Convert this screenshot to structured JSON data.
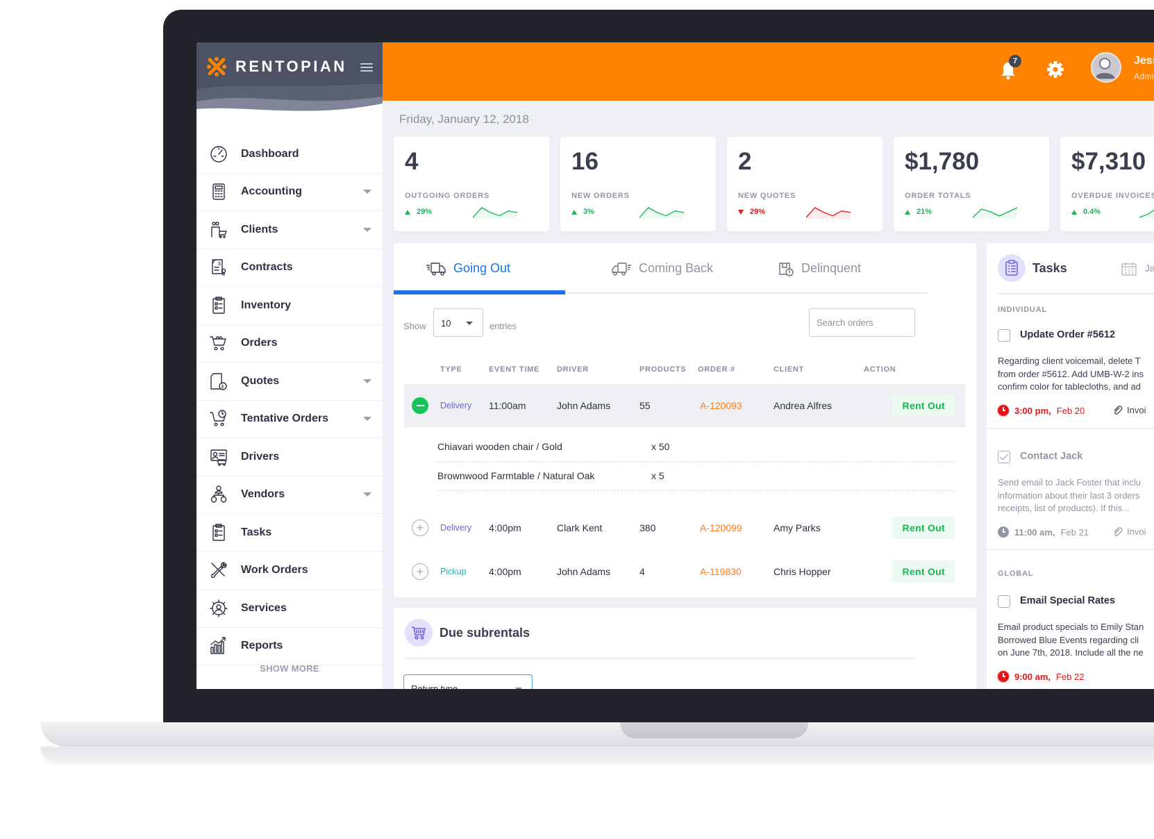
{
  "brand": {
    "name": "RENTOPIAN",
    "accent": "#ff8300",
    "sidebar_bg": "#4c5164"
  },
  "header": {
    "notification_count": "7",
    "user_name": "Jessica",
    "user_role": "Administrator"
  },
  "sidebar": {
    "items": [
      {
        "label": "Dashboard",
        "icon": "dashboard-gauge-icon",
        "expandable": false
      },
      {
        "label": "Accounting",
        "icon": "calculator-icon",
        "expandable": true
      },
      {
        "label": "Clients",
        "icon": "clients-cart-icon",
        "expandable": true
      },
      {
        "label": "Contracts",
        "icon": "contract-document-icon",
        "expandable": false
      },
      {
        "label": "Inventory",
        "icon": "clipboard-checklist-icon",
        "expandable": false
      },
      {
        "label": "Orders",
        "icon": "shopping-cart-icon",
        "expandable": false
      },
      {
        "label": "Quotes",
        "icon": "quote-document-dollar-icon",
        "expandable": true
      },
      {
        "label": "Tentative Orders",
        "icon": "cart-clock-icon",
        "expandable": true
      },
      {
        "label": "Drivers",
        "icon": "driver-id-card-icon",
        "expandable": false
      },
      {
        "label": "Vendors",
        "icon": "vendor-hierarchy-icon",
        "expandable": true
      },
      {
        "label": "Tasks",
        "icon": "clipboard-tasks-icon",
        "expandable": false
      },
      {
        "label": "Work Orders",
        "icon": "wrench-screwdriver-icon",
        "expandable": false
      },
      {
        "label": "Services",
        "icon": "services-gear-user-icon",
        "expandable": false
      },
      {
        "label": "Reports",
        "icon": "bar-chart-growth-icon",
        "expandable": false
      }
    ],
    "show_more": "SHOW MORE"
  },
  "main": {
    "date": "Friday, January 12, 2018",
    "stats": [
      {
        "value": "4",
        "label": "OUTGOING ORDERS",
        "change": "29%",
        "direction": "up",
        "color": "#16b653",
        "trend": [
          2,
          8,
          5,
          3,
          6,
          5
        ]
      },
      {
        "value": "16",
        "label": "NEW ORDERS",
        "change": "3%",
        "direction": "up",
        "color": "#16b653",
        "trend": [
          2,
          8,
          5,
          3,
          6,
          5
        ]
      },
      {
        "value": "2",
        "label": "NEW QUOTES",
        "change": "29%",
        "direction": "down",
        "color": "#e5131a",
        "trend": [
          2,
          8,
          5,
          3,
          6,
          5
        ]
      },
      {
        "value": "$1,780",
        "label": "ORDER TOTALS",
        "change": "21%",
        "direction": "up",
        "color": "#16b653",
        "trend": [
          2,
          8,
          6,
          3,
          6,
          9
        ]
      },
      {
        "value": "$7,310",
        "label": "OVERDUE INVOICES",
        "change": "0.4%",
        "direction": "up",
        "color": "#16b653",
        "trend": [
          2,
          4,
          8,
          7,
          6,
          7
        ]
      }
    ],
    "orders": {
      "tabs": [
        {
          "label": "Going Out",
          "icon": "truck-going-out-icon",
          "active": true
        },
        {
          "label": "Coming Back",
          "icon": "truck-coming-back-icon",
          "active": false
        },
        {
          "label": "Delinquent",
          "icon": "delinquent-package-icon",
          "active": false
        }
      ],
      "show_label": "Show",
      "entries_value": "10",
      "entries_label": "entries",
      "search_placeholder": "Search orders",
      "columns": [
        "TYPE",
        "EVENT TIME",
        "DRIVER",
        "PRODUCTS",
        "ORDER #",
        "CLIENT",
        "ACTION"
      ],
      "rows": [
        {
          "type": "Delivery",
          "type_color": "#6c63e0",
          "time": "11:00am",
          "driver": "John Adams",
          "products": "55",
          "order": "A-120093",
          "client": "Andrea Alfres",
          "action": "Rent Out",
          "expanded": true,
          "items": [
            {
              "name": "Chiavari wooden chair / Gold",
              "qty": "x 50"
            },
            {
              "name": "Brownwood Farmtable / Natural Oak",
              "qty": "x 5"
            }
          ]
        },
        {
          "type": "Delivery",
          "type_color": "#6c63e0",
          "time": "4:00pm",
          "driver": "Clark Kent",
          "products": "380",
          "order": "A-120099",
          "client": "Amy Parks",
          "action": "Rent Out",
          "expanded": false
        },
        {
          "type": "Pickup",
          "type_color": "#1fb5b0",
          "time": "4:00pm",
          "driver": "John Adams",
          "products": "4",
          "order": "A-119830",
          "client": "Chris Hopper",
          "action": "Rent Out",
          "expanded": false
        }
      ]
    },
    "subrentals": {
      "title": "Due subrentals",
      "return_select": "Return type"
    }
  },
  "tasks": {
    "title": "Tasks",
    "calendar_label": "Jan",
    "individual_label": "INDIVIDUAL",
    "global_label": "GLOBAL",
    "individual": [
      {
        "title": "Update Order #5612",
        "done": false,
        "desc": [
          "Regarding client voicemail, delete T",
          "from order #5612. Add UMB-W-2 ins",
          "confirm color for tablecloths, and ad"
        ],
        "due_time": "3:00 pm,",
        "due_date": "Feb 20",
        "overdue": true,
        "attachment": "Invoi"
      },
      {
        "title": "Contact Jack",
        "done": true,
        "desc": [
          "Send email to Jack Foster that inclu",
          "information about their last 3 orders",
          "receipts, list of products). If this..."
        ],
        "due_time": "11:00 am,",
        "due_date": "Feb 21",
        "overdue": false,
        "attachment": "Invoi"
      }
    ],
    "global": [
      {
        "title": "Email Special Rates",
        "done": false,
        "desc": [
          "Email product specials to Emily Stan",
          "Borrowed Blue Events regarding cli",
          "on June 7th, 2018. Include all the ne"
        ],
        "due_time": "9:00 am,",
        "due_date": "Feb 22",
        "overdue": true
      }
    ]
  }
}
